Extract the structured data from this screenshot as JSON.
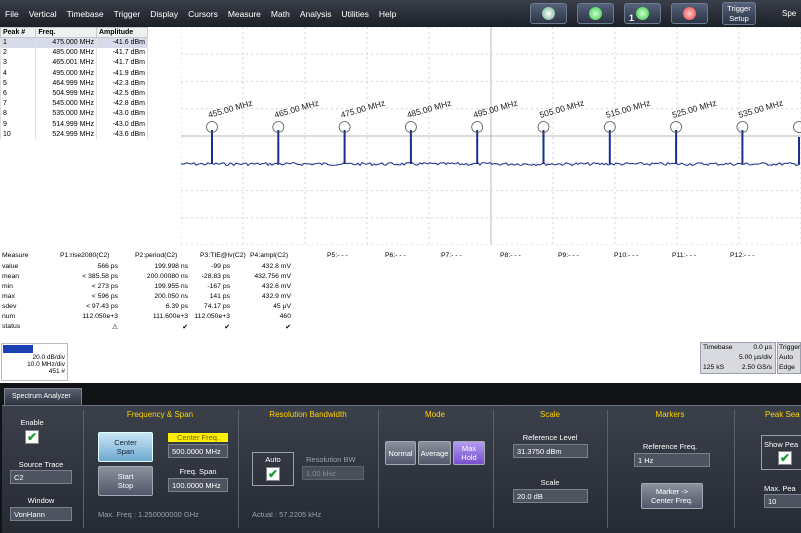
{
  "menu": [
    "File",
    "Vertical",
    "Timebase",
    "Trigger",
    "Display",
    "Cursors",
    "Measure",
    "Math",
    "Analysis",
    "Utilities",
    "Help"
  ],
  "toolbar": {
    "trigger_setup_line1": "Trigger",
    "trigger_setup_line2": "Setup",
    "channel_number": "1",
    "spec_cut": "Spe",
    "colors": {
      "run": "#36c443",
      "stop": "#e53a3a"
    }
  },
  "peak_table": {
    "headers": [
      "Peak #",
      "Freq.",
      "Amplitude"
    ],
    "rows": [
      [
        "1",
        "475.000 MHz",
        "-41.6 dBm"
      ],
      [
        "2",
        "485.000 MHz",
        "-41.7 dBm"
      ],
      [
        "3",
        "465.001 MHz",
        "-41.7 dBm"
      ],
      [
        "4",
        "495.000 MHz",
        "-41.9 dBm"
      ],
      [
        "5",
        "464.999 MHz",
        "-42.3 dBm"
      ],
      [
        "6",
        "504.999 MHz",
        "-42.5 dBm"
      ],
      [
        "7",
        "545.000 MHz",
        "-42.8 dBm"
      ],
      [
        "8",
        "535.000 MHz",
        "-43.0 dBm"
      ],
      [
        "9",
        "514.999 MHz",
        "-43.0 dBm"
      ],
      [
        "10",
        "524.999 MHz",
        "-43.6 dBm"
      ]
    ]
  },
  "trace": {
    "sp_label": "Sp",
    "markers": [
      "455.00 MHz",
      "465.00 MHz",
      "475.00 MHz",
      "485.00 MHz",
      "495.00 MHz",
      "505.00 MHz",
      "515.00 MHz",
      "525.00 MHz",
      "535.00 MHz"
    ],
    "trace_color": "#1a2e8a"
  },
  "measure": {
    "header": [
      "Measure",
      "P1:rise2080(C2)",
      "P2:period(C2)",
      "P3:TIE@lv(C2)",
      "P4:ampl(C2)",
      "P5:- - -",
      "P6:- - -",
      "P7:- - -",
      "P8:- - -",
      "P9:- - -",
      "P10:- - -",
      "P11:- - -",
      "P12:- - -"
    ],
    "rows": [
      [
        "value",
        "566 ps",
        "199.998 ns",
        "-99 ps",
        "432.8 mV"
      ],
      [
        "mean",
        "< 385.58 ps",
        "200.00080 ns",
        "-28.83 ps",
        "432.756 mV"
      ],
      [
        "min",
        "< 273 ps",
        "199.955 ns",
        "-167 ps",
        "432.6 mV"
      ],
      [
        "max",
        "< 596 ps",
        "200.050 ns",
        "141 ps",
        "432.9 mV"
      ],
      [
        "sdev",
        "< 97.43 ps",
        "6.39 ps",
        "74.17 ps",
        "45 µV"
      ],
      [
        "num",
        "112.050e+3",
        "111.600e+3",
        "112.050e+3",
        "460"
      ],
      [
        "status",
        "⚠",
        "✔",
        "✔",
        "✔"
      ]
    ]
  },
  "channel_box": {
    "line1": "20.0 dB/div",
    "line2": "10.0 MHz/div",
    "line3": "451 #"
  },
  "timebase_box": {
    "title": "Timebase",
    "offset": "0.0 µs",
    "div": "5.00 µs/div",
    "samples": "125 kS",
    "rate": "2.50 GS/s"
  },
  "trigger_box": {
    "title": "Trigger",
    "mode": "Auto",
    "type": "Edge"
  },
  "panel": {
    "tab": "Spectrum Analyzer",
    "enable_label": "Enable",
    "source_trace_label": "Source Trace",
    "source_trace_value": "C2",
    "window_label": "Window",
    "window_value": "VonHann",
    "freq_span_title": "Frequency & Span",
    "center_span_line1": "Center",
    "center_span_line2": "Span",
    "start_stop_line1": "Start",
    "start_stop_line2": "Stop",
    "center_freq_label": "Center Freq.",
    "center_freq_value": "500.0000 MHz",
    "freq_span_label": "Freq. Span",
    "freq_span_value": "100.0000 MHz",
    "max_freq": "Max. Freq :   1.250000000 GHz",
    "rbw_title": "Resolution Bandwidth",
    "auto_label": "Auto",
    "rbw_label": "Resolution BW",
    "rbw_value": "1.00 kHz",
    "actual": "Actual :      57.2205 kHz",
    "mode_title": "Mode",
    "mode_normal": "Normal",
    "mode_average": "Average",
    "mode_max_hold_line1": "Max",
    "mode_max_hold_line2": "Hold",
    "scale_title": "Scale",
    "ref_level_label": "Reference Level",
    "ref_level_value": "31.3750 dBm",
    "scale_label": "Scale",
    "scale_value": "20.0 dB",
    "markers_title": "Markers",
    "ref_freq_label": "Reference Freq.",
    "ref_freq_value": "1 Hz",
    "marker_btn_line1": "Marker ->",
    "marker_btn_line2": "Center Freq.",
    "peak_title": "Peak Sea",
    "show_peak_label": "Show Pea",
    "max_peak_label": "Max. Pea",
    "max_peak_value": "10"
  }
}
